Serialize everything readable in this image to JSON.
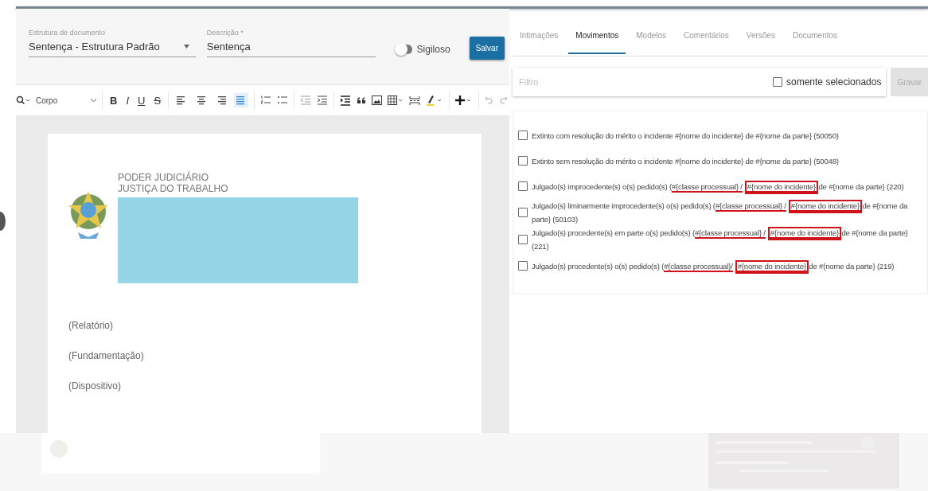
{
  "document_form": {
    "structure": {
      "label": "Estrutura de documento",
      "value": "Sentença - Estrutura Padrão"
    },
    "description": {
      "label": "Descrição *",
      "value": "Sentença"
    },
    "confidential": {
      "label": "Sigiloso",
      "on": false
    },
    "save_button": "Salvar"
  },
  "toolbar": {
    "style": "Corpo",
    "formats": [
      {
        "label": "B",
        "kind": "bold"
      },
      {
        "label": "I",
        "kind": "italic"
      },
      {
        "label": "U",
        "kind": "underline"
      },
      {
        "label": "S",
        "kind": "strike"
      }
    ],
    "alignments": [
      {
        "kind": "left",
        "selected": false
      },
      {
        "kind": "center",
        "selected": false
      },
      {
        "kind": "right",
        "selected": false
      },
      {
        "kind": "justify",
        "selected": true
      }
    ]
  },
  "document": {
    "header": [
      "PODER JUDICIÁRIO",
      "JUSTIÇA DO TRABALHO"
    ],
    "sections": [
      "(Relatório)",
      "(Fundamentação)",
      "(Dispositivo)"
    ]
  },
  "tabs": [
    {
      "label": "Intimações",
      "selected": false
    },
    {
      "label": "Movimentos",
      "selected": true
    },
    {
      "label": "Modelos",
      "selected": false
    },
    {
      "label": "Comentários",
      "selected": false
    },
    {
      "label": "Versões",
      "selected": false
    },
    {
      "label": "Documentos",
      "selected": false
    }
  ],
  "filter": {
    "placeholder": "Filtro",
    "only_selected": {
      "label": "somente selecionados",
      "checked": false
    },
    "button": "Gravar"
  },
  "movements": [
    {
      "checked": false,
      "parts": [
        {
          "kind": "plain",
          "text": "Extinto com resolução do mérito o incidente #{nome do incidente} de #{nome da parte} (50050)"
        }
      ]
    },
    {
      "checked": false,
      "parts": [
        {
          "kind": "plain",
          "text": "Extinto sem resolução do mérito o incidente #{nome do incidente} de #{nome da parte} (50048)"
        }
      ]
    },
    {
      "checked": false,
      "parts": [
        {
          "kind": "plain",
          "text": "Julgado(s) improcedente(s) o(s) pedido(s) ("
        },
        {
          "kind": "underlined",
          "text": "#{classe processual} /"
        },
        {
          "kind": "boxed",
          "text": "#{nome do incidente}"
        },
        {
          "kind": "plain",
          "text": " de #{nome da parte} (220)"
        }
      ]
    },
    {
      "checked": false,
      "parts": [
        {
          "kind": "plain",
          "text": "Julgado(s) liminarmente improcedente(s) o(s) pedido(s) ("
        },
        {
          "kind": "underlined",
          "text": "#{classe processual} /"
        },
        {
          "kind": "boxed",
          "text": "#{nome do incidente}"
        },
        {
          "kind": "plain",
          "text": " de #{nome da parte} (50103)"
        }
      ]
    },
    {
      "checked": false,
      "parts": [
        {
          "kind": "plain",
          "text": "Julgado(s) procedente(s) em parte o(s) pedido(s) ("
        },
        {
          "kind": "underlined",
          "text": "#{classe processual} /"
        },
        {
          "kind": "boxed",
          "text": "#{nome do incidente}"
        },
        {
          "kind": "plain",
          "text": " de #{nome da parte} (221)"
        }
      ]
    },
    {
      "checked": false,
      "parts": [
        {
          "kind": "plain",
          "text": "Julgado(s) procedente(s) o(s) pedido(s) ("
        },
        {
          "kind": "underlined",
          "text": "#{classe processual}/"
        },
        {
          "kind": "boxed",
          "text": "#{nome do incidente}"
        },
        {
          "kind": "plain",
          "text": " de #{nome da parte} (219)"
        }
      ]
    }
  ]
}
